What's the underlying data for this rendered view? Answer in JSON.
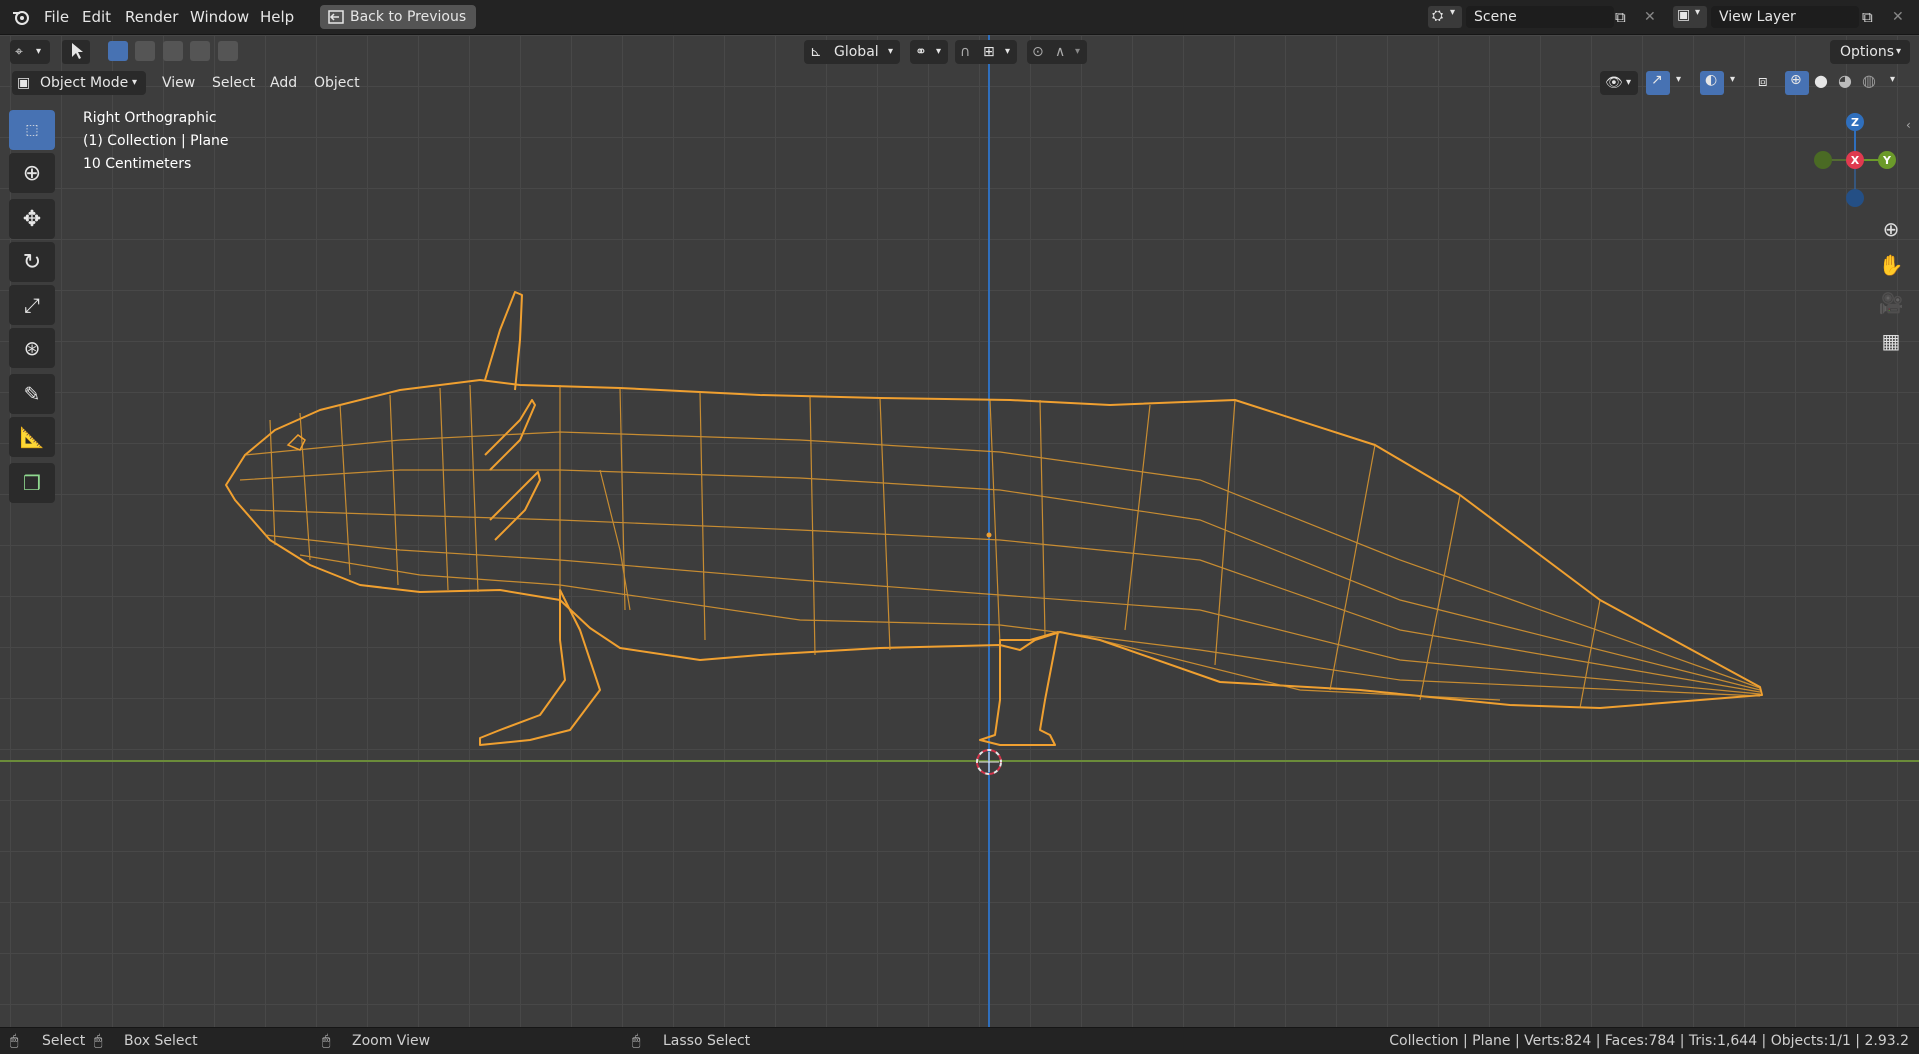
{
  "menubar": {
    "items": [
      "File",
      "Edit",
      "Render",
      "Window",
      "Help"
    ],
    "back_button": "Back to Previous",
    "scene": "Scene",
    "view_layer": "View Layer"
  },
  "toolbar": {
    "orientation": "Global",
    "options": "Options"
  },
  "header": {
    "mode": "Object Mode",
    "menus": [
      "View",
      "Select",
      "Add",
      "Object"
    ]
  },
  "viewport": {
    "view_name": "Right Orthographic",
    "collection_info": "(1) Collection | Plane",
    "scale_info": "10 Centimeters",
    "gizmo": {
      "z": "Z",
      "x": "X",
      "y": "Y"
    }
  },
  "statusbar": {
    "select": "Select",
    "box_select": "Box Select",
    "zoom_view": "Zoom View",
    "lasso_select": "Lasso Select",
    "stats": "Collection | Plane | Verts:824 | Faces:784 | Tris:1,644 | Objects:1/1 | 2.93.2"
  },
  "colors": {
    "accent": "#4772b3",
    "selection": "#f0a030",
    "x_axis": "#6b8c3a",
    "z_axis": "#2f6fbd"
  }
}
